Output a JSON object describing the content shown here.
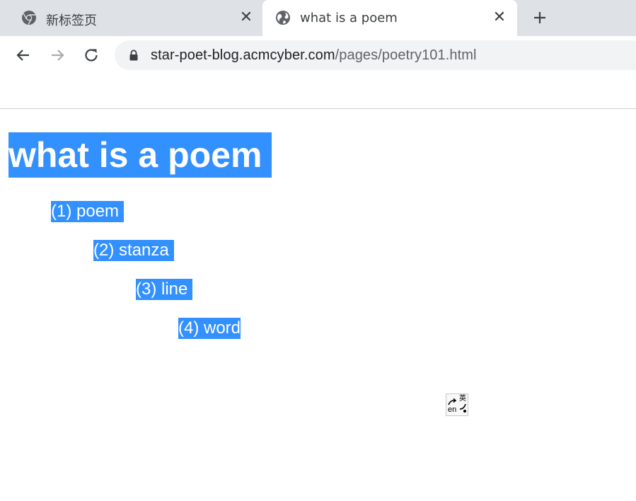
{
  "browser": {
    "tabs": [
      {
        "title": "新标签页",
        "active": false,
        "favicon": "chrome-icon"
      },
      {
        "title": "what is a poem",
        "active": true,
        "favicon": "globe-icon"
      }
    ],
    "close_glyph": "✕",
    "new_tab_icon": "plus-icon",
    "nav": {
      "back": "back-arrow-icon",
      "forward": "forward-arrow-icon",
      "reload": "reload-icon"
    },
    "url": {
      "host": "star-poet-blog.acmcyber.com",
      "path": "/pages/poetry101.html"
    }
  },
  "page": {
    "heading": "what is a poem",
    "items": [
      "(1) poem",
      "(2) stanza",
      "(3) line",
      "(4) word"
    ],
    "selection_color": "#3390ff"
  },
  "ime": {
    "en": "en",
    "zh": "英"
  },
  "colors": {
    "tabstrip": "#dee1e6",
    "omnibox": "#f1f3f4",
    "url_host": "#202124",
    "url_path": "#5f6368"
  }
}
